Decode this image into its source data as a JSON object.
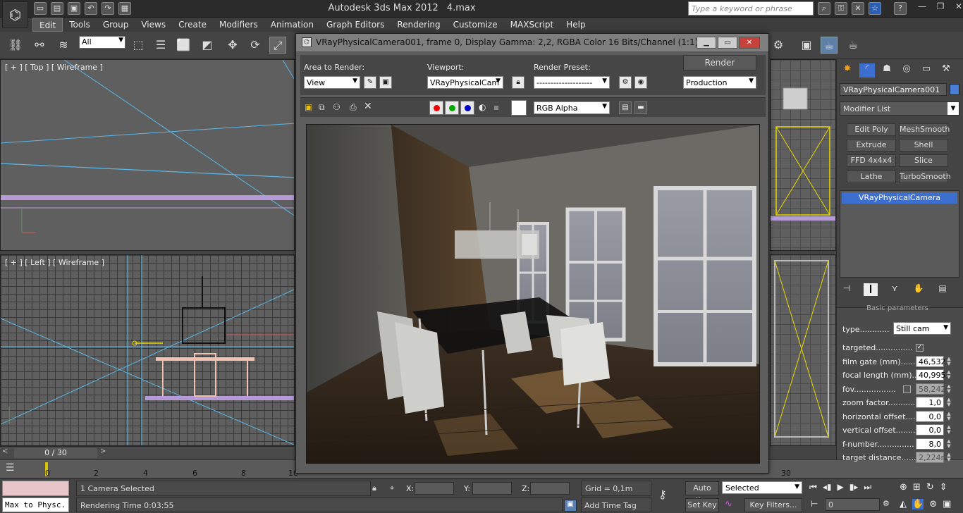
{
  "app": {
    "title": "Autodesk 3ds Max  2012",
    "filename": "4.max",
    "search_placeholder": "Type a keyword or phrase"
  },
  "menu": [
    "Edit",
    "Tools",
    "Group",
    "Views",
    "Create",
    "Modifiers",
    "Animation",
    "Graph Editors",
    "Rendering",
    "Customize",
    "MAXScript",
    "Help"
  ],
  "toolbar": {
    "selection_filter": "All"
  },
  "viewports": {
    "top_label": "[ + ] [ Top ] [ Wireframe ]",
    "left_label": "[ + ] [ Left ] [ Wireframe ]"
  },
  "timeslider": {
    "counter": "0 / 30",
    "prev": "<",
    "next": ">"
  },
  "trackbar": {
    "ticks": [
      "0",
      "2",
      "4",
      "6",
      "8",
      "10",
      "30"
    ]
  },
  "status": {
    "selection": "1 Camera Selected",
    "rendering_time": "Rendering Time  0:03:55",
    "maxscript": "Max to Physc.",
    "x_label": "X:",
    "y_label": "Y:",
    "z_label": "Z:",
    "grid": "Grid = 0,1m",
    "add_time_tag": "Add Time Tag",
    "auto_key": "Auto Key",
    "set_key": "Set Key",
    "selected": "Selected",
    "key_filters": "Key Filters...",
    "frame": "0"
  },
  "command_panel": {
    "object_name": "VRayPhysicalCamera001",
    "modifier_list": "Modifier List",
    "modifiers": [
      "Edit Poly",
      "MeshSmooth",
      "Extrude",
      "Shell",
      "FFD 4x4x4",
      "Slice",
      "Lathe",
      "TurboSmooth"
    ],
    "stack_item": "VRayPhysicalCamera",
    "rollout_title": "Basic parameters",
    "type_label": "type............",
    "type_value": "Still cam",
    "targeted_label": "targeted...............",
    "params": [
      {
        "label": "film gate (mm).......",
        "value": "46,532"
      },
      {
        "label": "focal length (mm).....",
        "value": "40,995"
      },
      {
        "label": "fov.................",
        "value": "58,242"
      },
      {
        "label": "zoom factor.............",
        "value": "1,0"
      },
      {
        "label": "horizontal offset.......",
        "value": "0,0"
      },
      {
        "label": "vertical offset.........",
        "value": "0,0"
      },
      {
        "label": "f-number...............",
        "value": "8,0"
      },
      {
        "label": "target distance.........",
        "value": "2,224m"
      }
    ]
  },
  "render_window": {
    "title": "VRayPhysicalCamera001, frame 0, Display Gamma: 2,2, RGBA Color 16 Bits/Channel (1:1)",
    "area_label": "Area to Render:",
    "area_value": "View",
    "viewport_label": "Viewport:",
    "viewport_value": "VRayPhysicalCam",
    "preset_label": "Render Preset:",
    "preset_value": "--------------------",
    "render_button": "Render",
    "production_value": "Production",
    "channel_value": "RGB Alpha"
  },
  "colors": {
    "selection_blue": "#3d6fd0",
    "object_color": "#4a7fd8",
    "close_red": "#c6433b",
    "wire_cyan": "#5ab8e8",
    "wire_purple": "#b79ad8",
    "furniture_pink": "#f0c0b0",
    "time_marker": "#d8c600"
  }
}
